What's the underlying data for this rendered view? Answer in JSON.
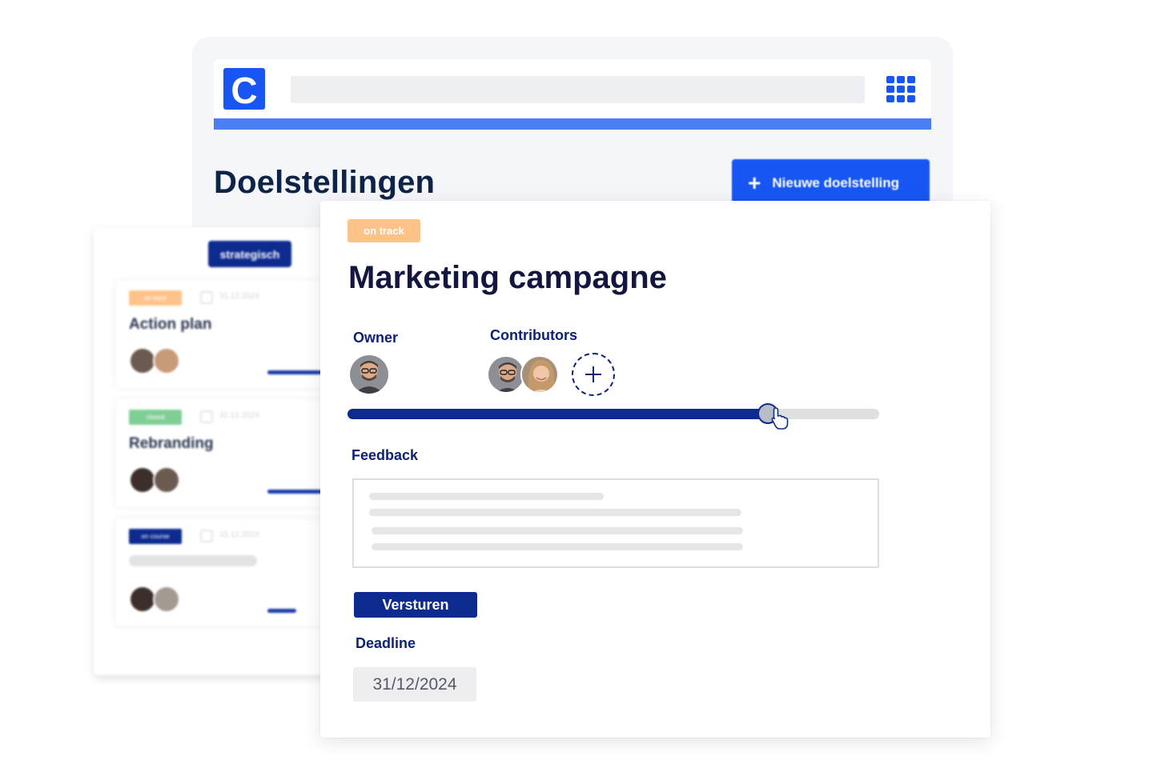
{
  "app": {
    "page_title": "Doelstellingen",
    "new_goal_label": "Nieuwe doelstelling",
    "logo_letter": "C"
  },
  "list": {
    "tag": "strategisch",
    "goals": [
      {
        "status": "on track",
        "status_color": "#ffc38a",
        "date": "31.12.2024",
        "name": "Action plan"
      },
      {
        "status": "closed",
        "status_color": "#7fcf95",
        "date": "31.12.2024",
        "name": "Rebranding"
      },
      {
        "status": "on course",
        "status_color": "#0d2a8f",
        "date": "31.12.2024",
        "name": ""
      }
    ]
  },
  "detail": {
    "status": "on track",
    "title": "Marketing campagne",
    "owner_label": "Owner",
    "contributors_label": "Contributors",
    "progress": 0.79,
    "feedback_label": "Feedback",
    "submit_label": "Versturen",
    "deadline_label": "Deadline",
    "deadline_value": "31/12/2024"
  },
  "colors": {
    "brand_blue": "#1756f2",
    "navy": "#0c2b8f",
    "accent_line": "#4a7ef5",
    "on_track": "#ffc38a"
  },
  "icons": [
    "app-logo-icon",
    "apps-grid-icon",
    "plus-icon",
    "calendar-icon",
    "add-contributor-icon",
    "pointer-cursor-icon"
  ]
}
